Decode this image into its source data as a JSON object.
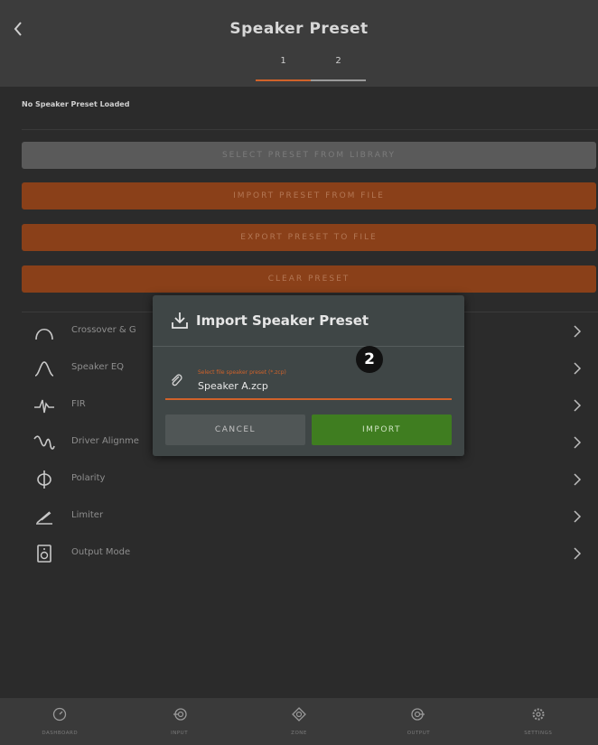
{
  "header": {
    "title": "Speaker Preset",
    "tabs": [
      {
        "label": "1",
        "active": true
      },
      {
        "label": "2",
        "active": false
      }
    ]
  },
  "status": "No Speaker Preset Loaded",
  "actions": {
    "select_preset": "SELECT PRESET FROM LIBRARY",
    "import_preset": "IMPORT PRESET FROM FILE",
    "export_preset": "EXPORT PRESET TO FILE",
    "clear_preset": "CLEAR PRESET"
  },
  "menu": [
    {
      "label": "Crossover & G",
      "icon": "crossover-icon"
    },
    {
      "label": "Speaker EQ",
      "icon": "eq-icon"
    },
    {
      "label": "FIR",
      "icon": "fir-icon"
    },
    {
      "label": "Driver Alignme",
      "icon": "alignment-icon"
    },
    {
      "label": "Polarity",
      "icon": "polarity-icon"
    },
    {
      "label": "Limiter",
      "icon": "limiter-icon"
    },
    {
      "label": "Output Mode",
      "icon": "speaker-icon"
    }
  ],
  "dialog": {
    "title": "Import Speaker Preset",
    "field_label": "Select file speaker preset (*.zcp)",
    "field_value": "Speaker A.zcp",
    "cancel": "CANCEL",
    "import": "IMPORT"
  },
  "step_badge": "2",
  "nav": [
    {
      "label": "DASHBOARD",
      "icon": "dashboard-icon"
    },
    {
      "label": "INPUT",
      "icon": "input-icon"
    },
    {
      "label": "ZONE",
      "icon": "zone-icon"
    },
    {
      "label": "OUTPUT",
      "icon": "output-icon"
    },
    {
      "label": "SETTINGS",
      "icon": "settings-icon"
    }
  ],
  "colors": {
    "accent": "#d0622a",
    "action_orange": "#8a4019",
    "import_green": "#3f7d20",
    "background": "#2b2b2b"
  }
}
